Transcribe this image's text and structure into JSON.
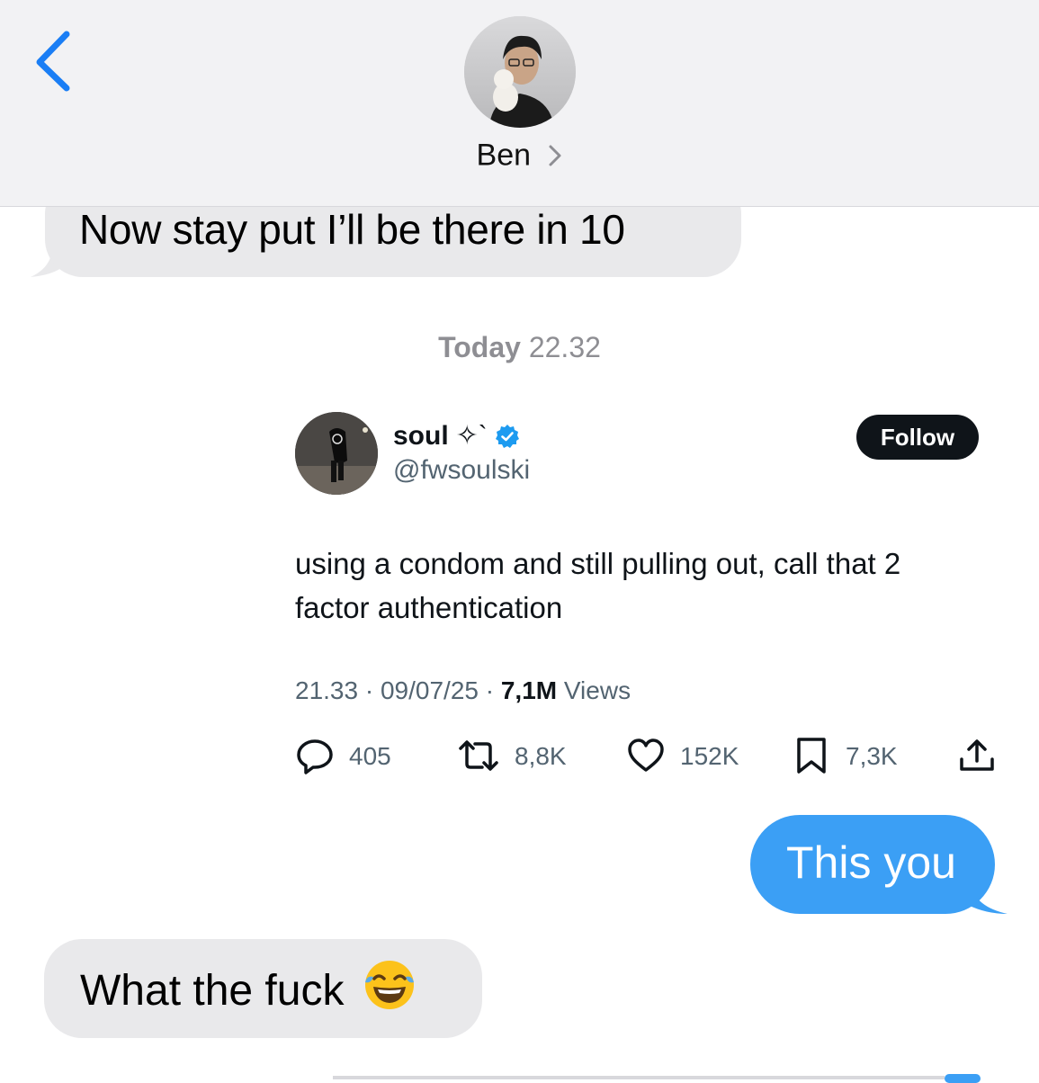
{
  "header": {
    "contact_name": "Ben",
    "back_icon": "chevron-left-icon",
    "disclosure_icon": "chevron-right-icon"
  },
  "messages": [
    {
      "direction": "incoming",
      "text": "Now stay put I’ll be there in 10"
    }
  ],
  "timestamp": {
    "day": "Today",
    "time": "22.32"
  },
  "tweet": {
    "display_name": "soul",
    "name_suffix": "✧`",
    "verified": true,
    "handle": "@fwsoulski",
    "follow_label": "Follow",
    "text": "using a condom and still pulling out, call that 2 factor authentication",
    "time": "21.33",
    "date": "09/07/25",
    "views_count": "7,1M",
    "views_label": "Views",
    "replies": "405",
    "reposts": "8,8K",
    "likes": "152K",
    "bookmarks": "7,3K"
  },
  "outgoing_message": {
    "text": "This you"
  },
  "reply_message": {
    "text": "What the fuck",
    "emoji": "😂"
  },
  "colors": {
    "incoming_bubble": "#e9e9eb",
    "outgoing_bubble": "#3b9ff5",
    "header_bg": "#f2f2f4",
    "ios_blue": "#007aff",
    "twitter_verified": "#1d9bf0"
  }
}
